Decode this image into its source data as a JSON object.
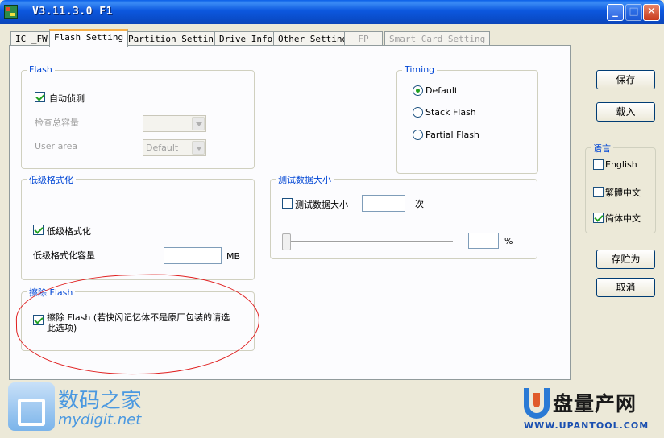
{
  "window": {
    "title": "V3.11.3.0 F1"
  },
  "titlebar_buttons": {
    "minimize": "_",
    "maximize": "□",
    "close": "✕"
  },
  "tabs": [
    {
      "label": "IC _FW",
      "state": "normal"
    },
    {
      "label": "Flash Setting",
      "state": "active"
    },
    {
      "label": "Partition Setting",
      "state": "normal"
    },
    {
      "label": "Drive Info",
      "state": "normal"
    },
    {
      "label": "Other Setting",
      "state": "normal"
    },
    {
      "label": "FP",
      "state": "disabled"
    },
    {
      "label": "Smart Card Setting",
      "state": "disabled"
    }
  ],
  "flash_group": {
    "title": "Flash",
    "auto_detect": {
      "label": "自动侦测",
      "checked": true
    },
    "check_capacity": {
      "label": "检查总容量",
      "value": ""
    },
    "user_area": {
      "label": "User area",
      "value": "Default"
    }
  },
  "timing_group": {
    "title": "Timing",
    "options": [
      {
        "label": "Default",
        "selected": true
      },
      {
        "label": "Stack Flash",
        "selected": false
      },
      {
        "label": "Partial Flash",
        "selected": false
      }
    ]
  },
  "lowformat_group": {
    "title": "低级格式化",
    "enable": {
      "label": "低级格式化",
      "checked": true
    },
    "capacity_label": "低级格式化容量",
    "capacity_value": "",
    "unit": "MB"
  },
  "testsize_group": {
    "title": "测试数据大小",
    "enable": {
      "label": "测试数据大小",
      "checked": false
    },
    "count_value": "",
    "count_unit": "次",
    "percent_value": "",
    "percent_unit": "%"
  },
  "erase_group": {
    "title": "擦除 Flash",
    "enable": {
      "label_line1": "擦除 Flash (若快闪记忆体不是原厂包装的请选",
      "label_line2": "此选项)",
      "checked": true
    }
  },
  "buttons": {
    "save": "保存",
    "load": "载入",
    "save_as": "存贮为",
    "cancel": "取消"
  },
  "language_group": {
    "title": "语言",
    "options": [
      {
        "label": "English",
        "checked": false
      },
      {
        "label": "繁體中文",
        "checked": false
      },
      {
        "label": "简体中文",
        "checked": true
      }
    ]
  },
  "watermarks": {
    "left_cn": "数码之家",
    "left_en": "mydigit.net",
    "right_cn": "盘量产网",
    "right_url": "WWW.UPANTOOL.COM"
  },
  "colors": {
    "titlebar": "#0A4CC8",
    "group_title": "#0046d5",
    "annotation_oval": "#e02020",
    "check": "#21a121"
  }
}
